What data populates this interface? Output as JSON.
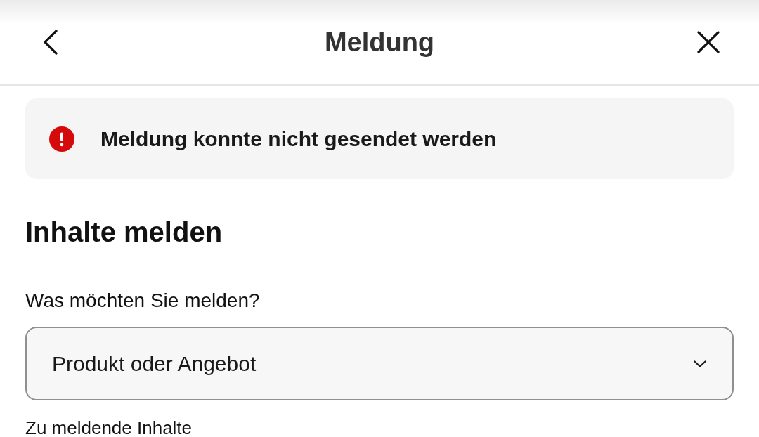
{
  "header": {
    "title": "Meldung"
  },
  "alert": {
    "kind": "error",
    "message": "Meldung konnte nicht gesendet werden"
  },
  "form": {
    "heading": "Inhalte melden",
    "fields": [
      {
        "kind": "select",
        "label": "Was möchten Sie melden?",
        "value": "Produkt oder Angebot"
      }
    ],
    "next_section_label": "Zu meldende Inhalte"
  }
}
